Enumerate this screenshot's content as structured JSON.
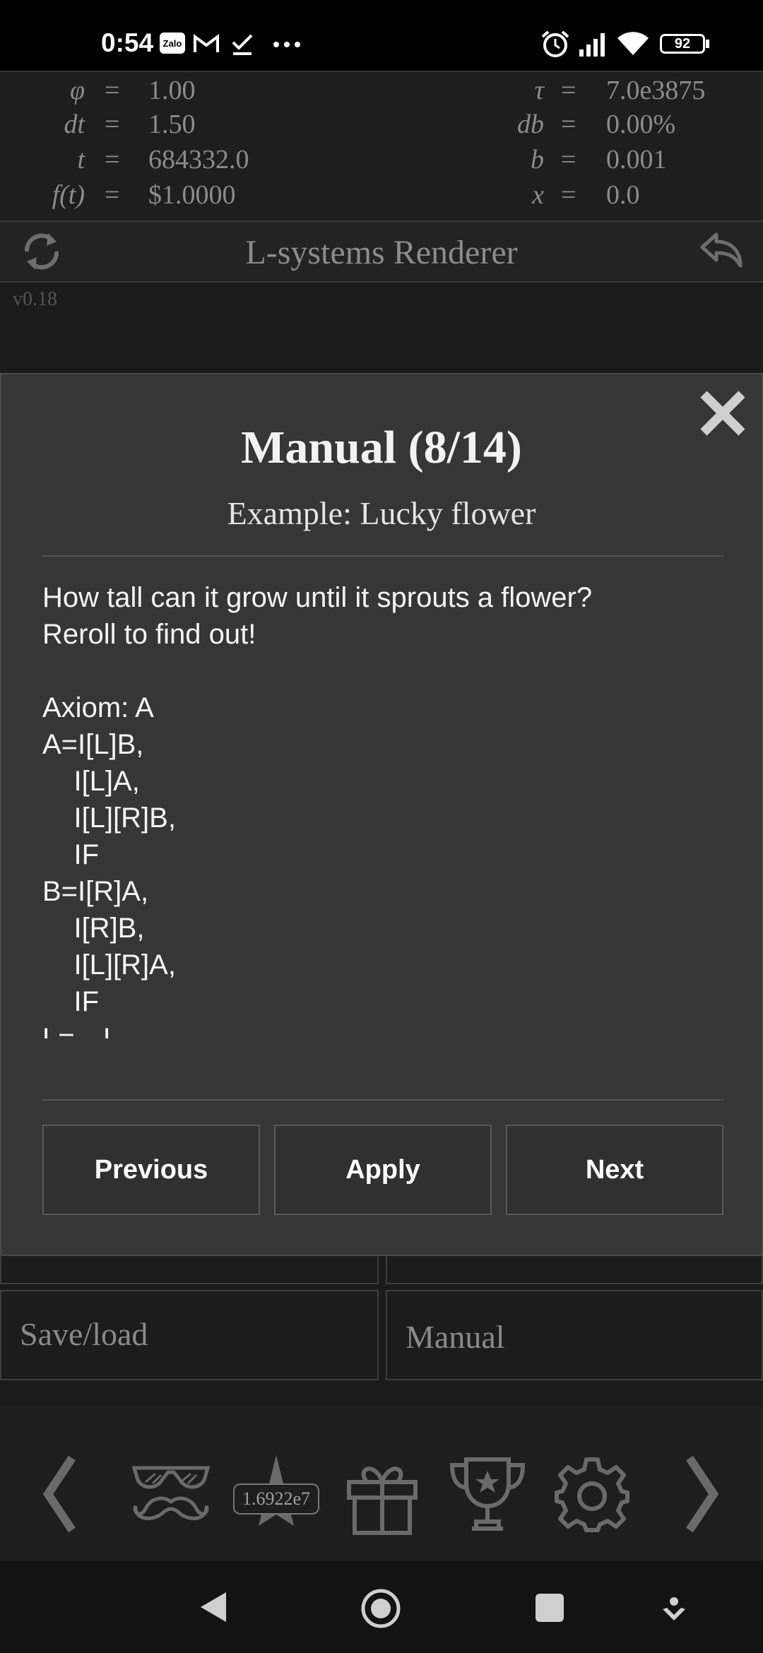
{
  "status_bar": {
    "time": "0:54",
    "notif_zalo": "Zalo",
    "battery": "92",
    "icons": [
      "zalo-icon",
      "gmail-icon",
      "check-icon",
      "more-dots-icon",
      "alarm-icon",
      "signal-icon",
      "wifi-icon",
      "battery-icon"
    ]
  },
  "equations": {
    "left": [
      {
        "var": "φ",
        "eq": "=",
        "val": "1.00"
      },
      {
        "var": "dt",
        "eq": "=",
        "val": "1.50"
      },
      {
        "var": "t",
        "eq": "=",
        "val": "684332.0"
      },
      {
        "var": "f(t)",
        "eq": "=",
        "val": "$1.0000"
      }
    ],
    "right": [
      {
        "var": "τ",
        "eq": "=",
        "val": "7.0e3875"
      },
      {
        "var": "db",
        "eq": "=",
        "val": "0.00%"
      },
      {
        "var": "b",
        "eq": "=",
        "val": "0.001"
      },
      {
        "var": "x",
        "eq": "=",
        "val": "0.0"
      }
    ]
  },
  "header": {
    "title": "L-systems Renderer",
    "version": "v0.18"
  },
  "modal": {
    "title": "Manual (8/14)",
    "subtitle": "Example: Lucky flower",
    "body": "How tall can it grow until it sprouts a flower?\nReroll to find out!\n\nAxiom: A\nA=I[L]B,\n    I[L]A,\n    I[L][R]B,\n    IF\nB=I[R]A,\n    I[R]B,\n    I[L][R]A,\n    IF\nL=---I,\n        I",
    "buttons": {
      "previous": "Previous",
      "apply": "Apply",
      "next": "Next"
    }
  },
  "lower_buttons": {
    "save_load": "Save/load",
    "manual": "Manual"
  },
  "bottom_nav": {
    "badge": "1.6922e7",
    "icons": [
      "chevron-left-icon",
      "disguise-icon",
      "star-icon",
      "gift-icon",
      "trophy-icon",
      "gear-icon",
      "chevron-right-icon"
    ]
  },
  "colors": {
    "background": "#1b1b1b",
    "modal": "#363636",
    "text_dim": "#8c8c8c"
  }
}
